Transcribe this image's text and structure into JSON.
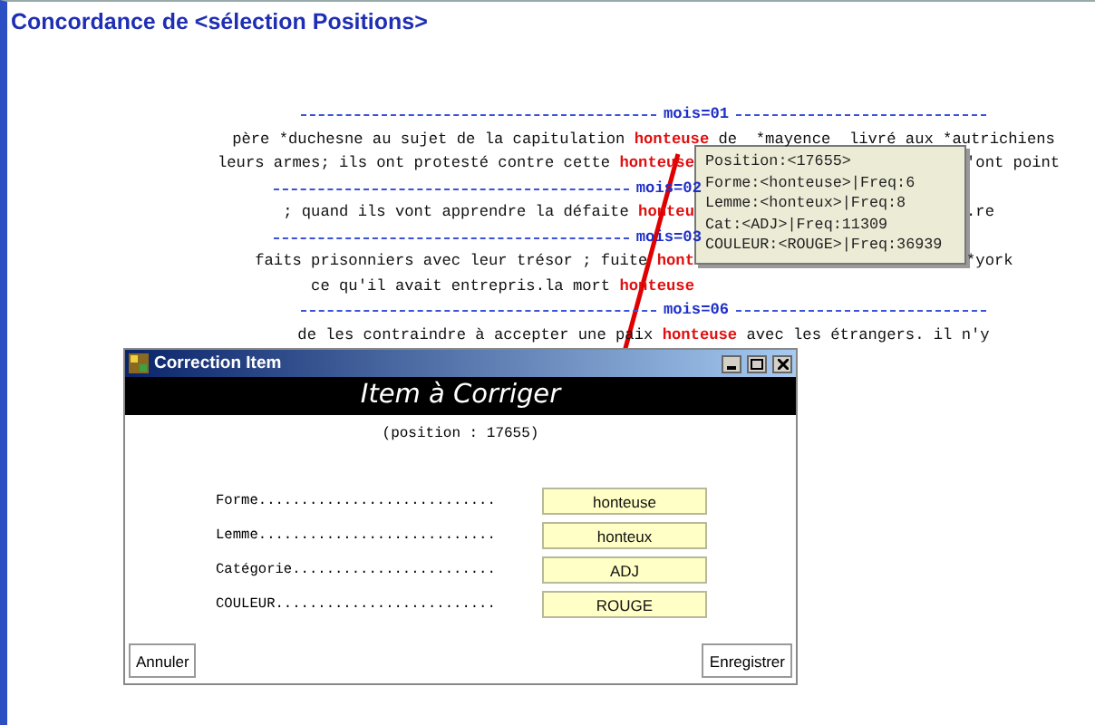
{
  "window": {
    "title": "Concordance de <sélection Positions>"
  },
  "concordance": [
    {
      "kind": "separator",
      "label": "mois=01"
    },
    {
      "kind": "line",
      "before": "père *duchesne au sujet de la capitulation ",
      "keyword": "honteuse",
      "after": " de  *mayence  livré aux *autrichiens"
    },
    {
      "kind": "covered_line",
      "before": "leurs armes; ils ont protesté contre cette ",
      "keyword": "honteuse",
      "tail": "'ont point"
    },
    {
      "kind": "covered_separator",
      "label": "mois=02"
    },
    {
      "kind": "covered_line",
      "before": "; quand ils vont apprendre la défaite ",
      "keyword": "honteu",
      "tail": ".re"
    },
    {
      "kind": "covered_separator",
      "label": "mois=03"
    },
    {
      "kind": "covered_line",
      "before": "faits prisonniers avec leur trésor ; fuite ",
      "keyword": "hont",
      "tail": "*york"
    },
    {
      "kind": "covered_line",
      "before": "ce qu'il avait entrepris.la mort ",
      "keyword": "honteuse"
    },
    {
      "kind": "separator",
      "label": "mois=06"
    },
    {
      "kind": "line",
      "before": "de les contraindre à accepter une paix ",
      "keyword": "honteuse",
      "after": " avec les étrangers. il n'y"
    }
  ],
  "tooltip": {
    "lines": [
      "Position:<17655>",
      "Forme:<honteuse>|Freq:6",
      "Lemme:<honteux>|Freq:8",
      "Cat:<ADJ>|Freq:11309",
      "COULEUR:<ROUGE>|Freq:36939"
    ]
  },
  "dialog": {
    "title": "Correction Item",
    "heading": "Item à Corriger",
    "position": "(position : 17655)",
    "fields": [
      {
        "label": "Forme............................",
        "value": "honteuse"
      },
      {
        "label": "Lemme............................",
        "value": "honteux"
      },
      {
        "label": "Catégorie........................",
        "value": "ADJ"
      },
      {
        "label": "COULEUR..........................",
        "value": "ROUGE"
      }
    ],
    "buttons": [
      "Annuler",
      "Enregistrer"
    ]
  }
}
